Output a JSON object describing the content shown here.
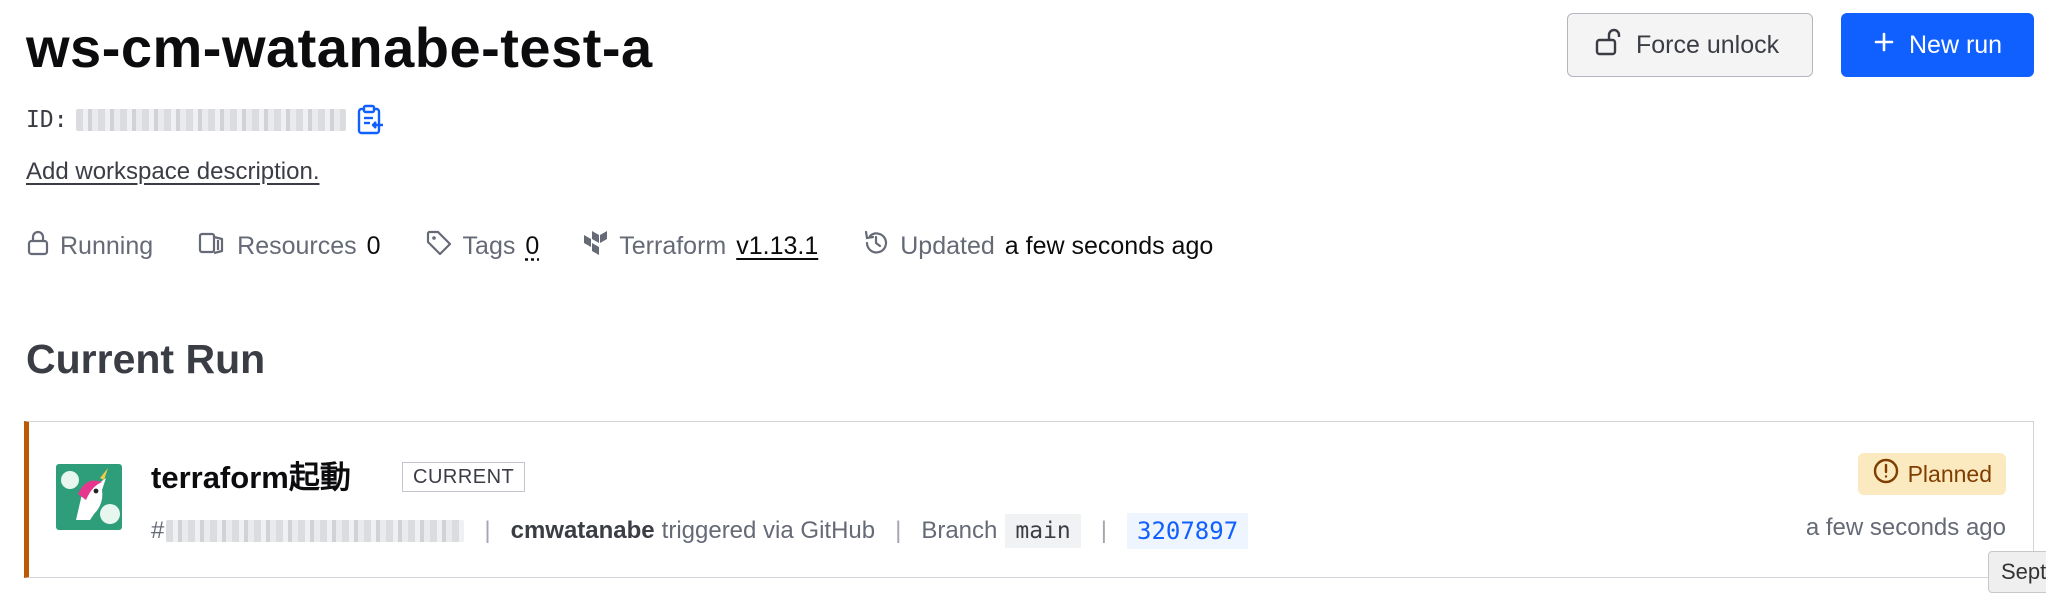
{
  "workspace": {
    "name": "ws-cm-watanabe-test-a",
    "id_label": "ID:",
    "description_link": "Add workspace description."
  },
  "actions": {
    "force_unlock": "Force unlock",
    "new_run": "New run"
  },
  "meta": {
    "status": "Running",
    "resources_label": "Resources",
    "resources_count": "0",
    "tags_label": "Tags",
    "tags_count": "0",
    "terraform_label": "Terraform",
    "terraform_version": "v1.13.1",
    "updated_label": "Updated",
    "updated_value": "a few seconds ago"
  },
  "current_run": {
    "section_title": "Current Run",
    "title": "terraform起動",
    "badge": "CURRENT",
    "hash_prefix": "#",
    "user": "cmwatanabe",
    "trigger_text": "triggered via GitHub",
    "branch_label": "Branch",
    "branch": "main",
    "commit": "3207897",
    "status": "Planned",
    "time": "a few seconds ago"
  },
  "tooltip_fragment": "Sept",
  "colors": {
    "primary": "#1060ff",
    "warning_bg": "#fbeabf",
    "warning_text": "#803d00",
    "run_accent": "#bb5a00"
  },
  "icons": {
    "force_unlock": "unlock-icon",
    "new_run": "plus-icon",
    "copy": "copy-clipboard-icon",
    "status": "lock-icon",
    "resources": "resources-icon",
    "tags": "tag-icon",
    "terraform": "terraform-logo-icon",
    "updated": "history-icon",
    "planned": "alert-circle-icon"
  }
}
